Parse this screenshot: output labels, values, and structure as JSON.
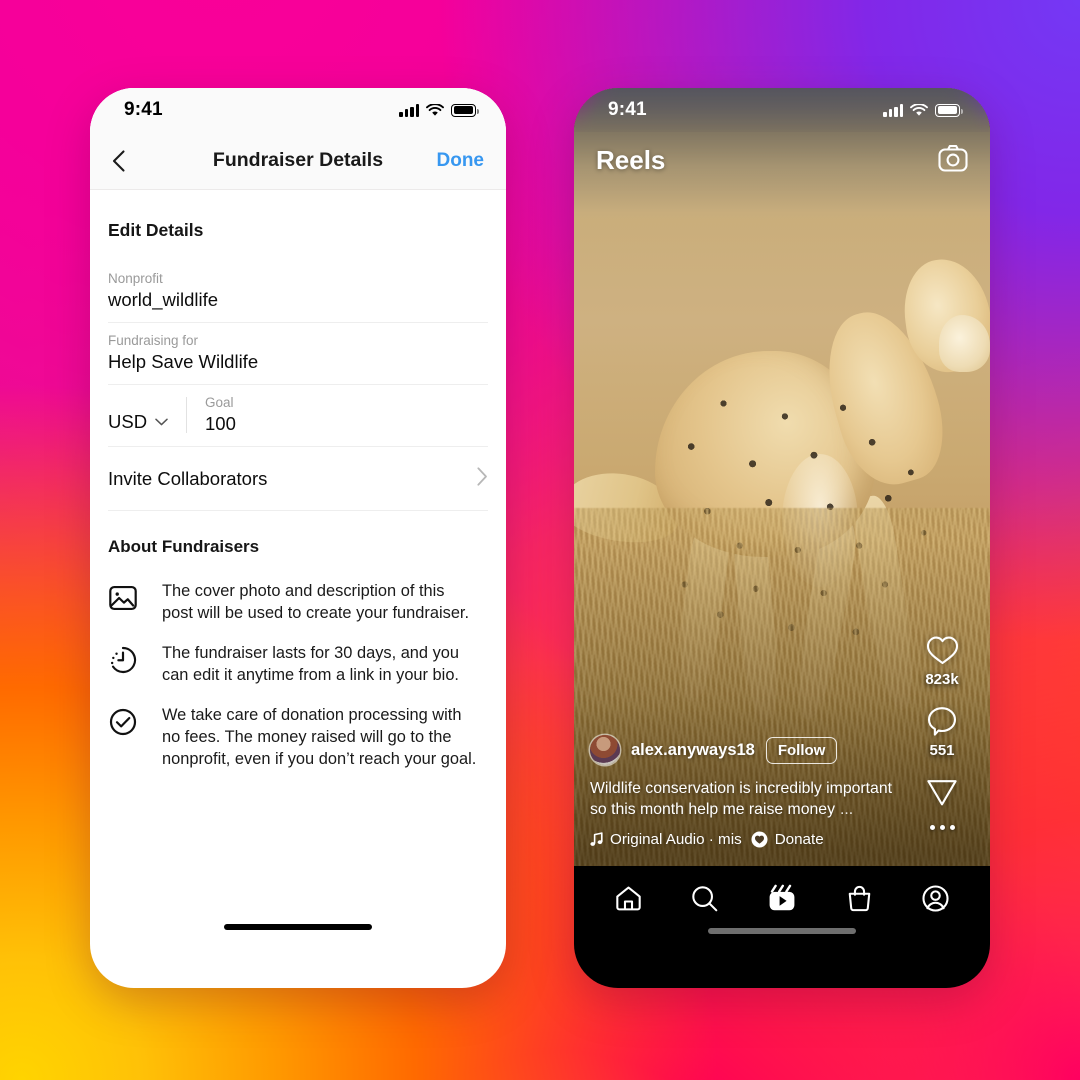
{
  "background": {
    "gradient_colors": [
      "#FA0098",
      "#7438F5",
      "#FF0055",
      "#FF6A00",
      "#FFC107"
    ]
  },
  "left_phone": {
    "status_bar": {
      "time": "9:41",
      "cellular_icon": "signal-bars-icon",
      "wifi_icon": "wifi-icon",
      "battery_icon": "battery-icon"
    },
    "nav": {
      "back_icon": "chevron-left-icon",
      "title": "Fundraiser Details",
      "done_label": "Done",
      "done_color": "#3797F0"
    },
    "section_title": "Edit Details",
    "fields": [
      {
        "label": "Nonprofit",
        "value": "world_wildlife"
      },
      {
        "label": "Fundraising for",
        "value": "Help Save Wildlife"
      }
    ],
    "currency": {
      "value": "USD",
      "chevron_icon": "chevron-down-icon"
    },
    "goal": {
      "label": "Goal",
      "value": "100"
    },
    "invite": {
      "label": "Invite Collaborators",
      "chevron_icon": "chevron-right-icon"
    },
    "about": {
      "title": "About Fundraisers",
      "items": [
        {
          "icon": "photo-icon",
          "text": "The cover photo and description of this post will be used to create your fundraiser."
        },
        {
          "icon": "clock-icon",
          "text": "The fundraiser lasts for 30 days, and you can edit it anytime from a link in your bio."
        },
        {
          "icon": "check-circle-icon",
          "text": "We take care of donation processing with no fees. The money raised will go to the nonprofit, even if you don’t reach your goal."
        }
      ]
    }
  },
  "right_phone": {
    "status_bar": {
      "time": "9:41",
      "cellular_icon": "signal-bars-icon",
      "wifi_icon": "wifi-icon",
      "battery_icon": "battery-icon"
    },
    "header": {
      "title": "Reels",
      "camera_icon": "camera-icon"
    },
    "media": {
      "description": "cheetah walking through dry savanna grass"
    },
    "actions": [
      {
        "icon": "heart-icon",
        "count": "823k"
      },
      {
        "icon": "comment-icon",
        "count": "551"
      },
      {
        "icon": "share-icon",
        "count": ""
      },
      {
        "icon": "more-dots-icon",
        "count": ""
      }
    ],
    "post": {
      "avatar": "user-avatar",
      "username": "alex.anyways18",
      "follow_label": "Follow",
      "caption": "Wildlife conservation is incredibly important so this month help me raise money",
      "caption_more": "...",
      "audio_icon": "music-note-icon",
      "audio_label": "Original Audio · mis",
      "donate_icon": "donate-heart-icon",
      "donate_label": "Donate"
    },
    "bottom_nav": [
      {
        "icon": "home-icon"
      },
      {
        "icon": "search-icon"
      },
      {
        "icon": "reels-icon"
      },
      {
        "icon": "shop-icon"
      },
      {
        "icon": "profile-icon"
      }
    ]
  }
}
